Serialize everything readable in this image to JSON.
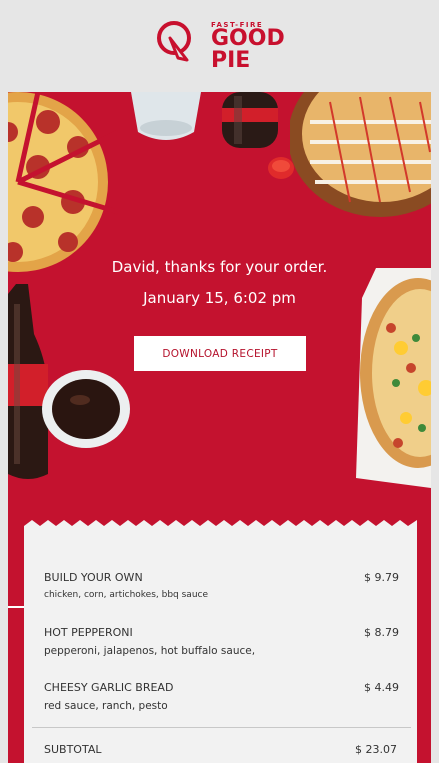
{
  "brand": {
    "tagline": "FAST-FIRE",
    "name_line1": "GOOD",
    "name_line2": "PIE",
    "color": "#c8102e"
  },
  "hero": {
    "greeting": "David, thanks for your order.",
    "datetime": "January 15, 6:02 pm",
    "receipt_button": "DOWNLOAD RECEIPT",
    "background": "#c4122f"
  },
  "order": {
    "items": [
      {
        "name": "BUILD YOUR OWN",
        "price": "$ 9.79",
        "description": "chicken, corn, artichokes, bbq sauce"
      },
      {
        "name": "HOT PEPPERONI",
        "price": "$ 8.79",
        "description": "pepperoni, jalapenos, hot buffalo sauce,"
      },
      {
        "name": "CHEESY GARLIC BREAD",
        "price": "$ 4.49",
        "description": "red sauce, ranch, pesto"
      }
    ],
    "subtotal_label": "SUBTOTAL",
    "subtotal_value": "$ 23.07"
  }
}
